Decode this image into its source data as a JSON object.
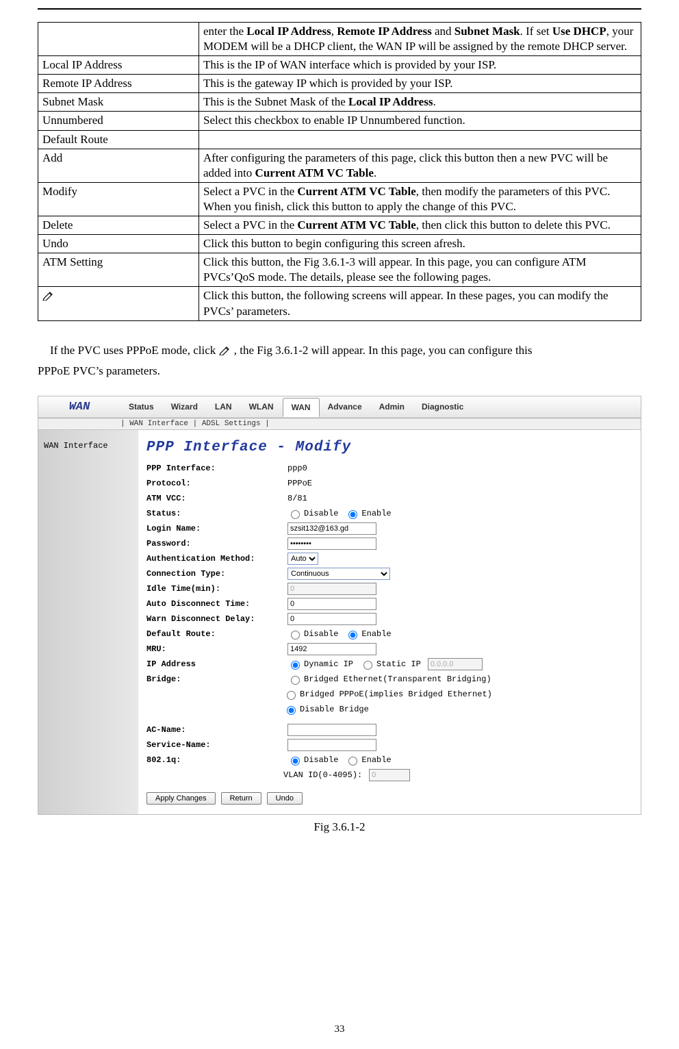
{
  "table": {
    "rows": [
      {
        "key": "",
        "desc_parts": [
          "enter the ",
          {
            "b": "Local IP Address"
          },
          ", ",
          {
            "b": "Remote IP Address"
          },
          " and ",
          {
            "b": "Subnet Mask"
          },
          ". If set ",
          {
            "b": "Use DHCP"
          },
          ", your MODEM will be a DHCP client, the WAN IP will be assigned by the remote DHCP server."
        ]
      },
      {
        "key": "Local IP Address",
        "desc_parts": [
          "This is the IP of WAN interface which is provided by your ISP."
        ]
      },
      {
        "key": "Remote IP Address",
        "desc_parts": [
          "This is the gateway IP which is provided by your ISP."
        ]
      },
      {
        "key": "Subnet Mask",
        "desc_parts": [
          "This is the Subnet Mask of the ",
          {
            "b": "Local IP Address"
          },
          "."
        ]
      },
      {
        "key": "Unnumbered",
        "desc_parts": [
          "Select this checkbox to enable IP Unnumbered function."
        ]
      },
      {
        "key": "Default Route",
        "desc_parts": [
          ""
        ]
      },
      {
        "key": "Add",
        "desc_parts": [
          "After configuring the parameters of this page, click this button then a new PVC will be added into ",
          {
            "b": "Current ATM VC Table"
          },
          "."
        ]
      },
      {
        "key": "Modify",
        "desc_parts": [
          "Select a PVC in the ",
          {
            "b": "Current ATM VC Table"
          },
          ", then modify the parameters of this PVC. When you finish, click this button to apply the change of this PVC."
        ]
      },
      {
        "key": "Delete",
        "desc_parts": [
          "Select a PVC in the ",
          {
            "b": "Current ATM VC Table"
          },
          ", then click this button to delete this PVC."
        ]
      },
      {
        "key": "Undo",
        "desc_parts": [
          "Click this button to begin configuring this screen afresh."
        ]
      },
      {
        "key": "ATM Setting",
        "desc_parts": [
          "Click this button, the Fig 3.6.1-3 will appear. In this page, you can configure ATM PVCs’QoS mode. The details, please see the following pages."
        ]
      },
      {
        "key": "__PENCIL__",
        "desc_parts": [
          "Click this button, the following screens will appear. In these pages, you can modify the PVCs’ parameters."
        ]
      }
    ]
  },
  "body_text": {
    "before": "If the PVC uses PPPoE mode, click ",
    "after": " , the Fig 3.6.1-2 will appear. In this page, you can configure this ",
    "line2": "PPPoE PVC’s parameters."
  },
  "fig": {
    "brand": "WAN",
    "tabs": [
      "Status",
      "Wizard",
      "LAN",
      "WLAN",
      "WAN",
      "Advance",
      "Admin",
      "Diagnostic"
    ],
    "subtabs": "| WAN Interface | ADSL Settings |",
    "side": "WAN Interface",
    "title": "PPP Interface - Modify",
    "rows": {
      "ppp_if": {
        "lbl": "PPP Interface:",
        "val": "ppp0"
      },
      "protocol": {
        "lbl": "Protocol:",
        "val": "PPPoE"
      },
      "vcc": {
        "lbl": "ATM VCC:",
        "val": "8/81"
      },
      "status": {
        "lbl": "Status:",
        "opts": [
          "Disable",
          "Enable"
        ],
        "sel": 1
      },
      "login": {
        "lbl": "Login Name:",
        "val": "szsit132@163.gd"
      },
      "password": {
        "lbl": "Password:",
        "val": "••••••••"
      },
      "auth": {
        "lbl": "Authentication Method:",
        "val": "Auto"
      },
      "conn": {
        "lbl": "Connection Type:",
        "val": "Continuous"
      },
      "idle": {
        "lbl": "Idle Time(min):",
        "val": "0"
      },
      "autod": {
        "lbl": "Auto Disconnect Time:",
        "val": "0"
      },
      "warn": {
        "lbl": "Warn Disconnect Delay:",
        "val": "0"
      },
      "defroute": {
        "lbl": "Default Route:",
        "opts": [
          "Disable",
          "Enable"
        ],
        "sel": 1
      },
      "mru": {
        "lbl": "MRU:",
        "val": "1492"
      },
      "ip": {
        "lbl": "IP Address",
        "opts": [
          "Dynamic IP",
          "Static IP"
        ],
        "sel": 0,
        "static_val": "0.0.0.0"
      },
      "bridge": {
        "lbl": "Bridge:",
        "opts": [
          "Bridged Ethernet(Transparent Bridging)",
          "Bridged PPPoE(implies Bridged Ethernet)",
          "Disable Bridge"
        ],
        "sel": 2
      },
      "ac": {
        "lbl": "AC-Name:",
        "val": ""
      },
      "svc": {
        "lbl": "Service-Name:",
        "val": ""
      },
      "dot1q": {
        "lbl": "802.1q:",
        "opts": [
          "Disable",
          "Enable"
        ],
        "sel": 0,
        "vlan_lbl": "VLAN ID(0-4095):",
        "vlan_val": "0"
      }
    },
    "buttons": [
      "Apply Changes",
      "Return",
      "Undo"
    ]
  },
  "caption": "Fig 3.6.1-2",
  "page_number": "33"
}
